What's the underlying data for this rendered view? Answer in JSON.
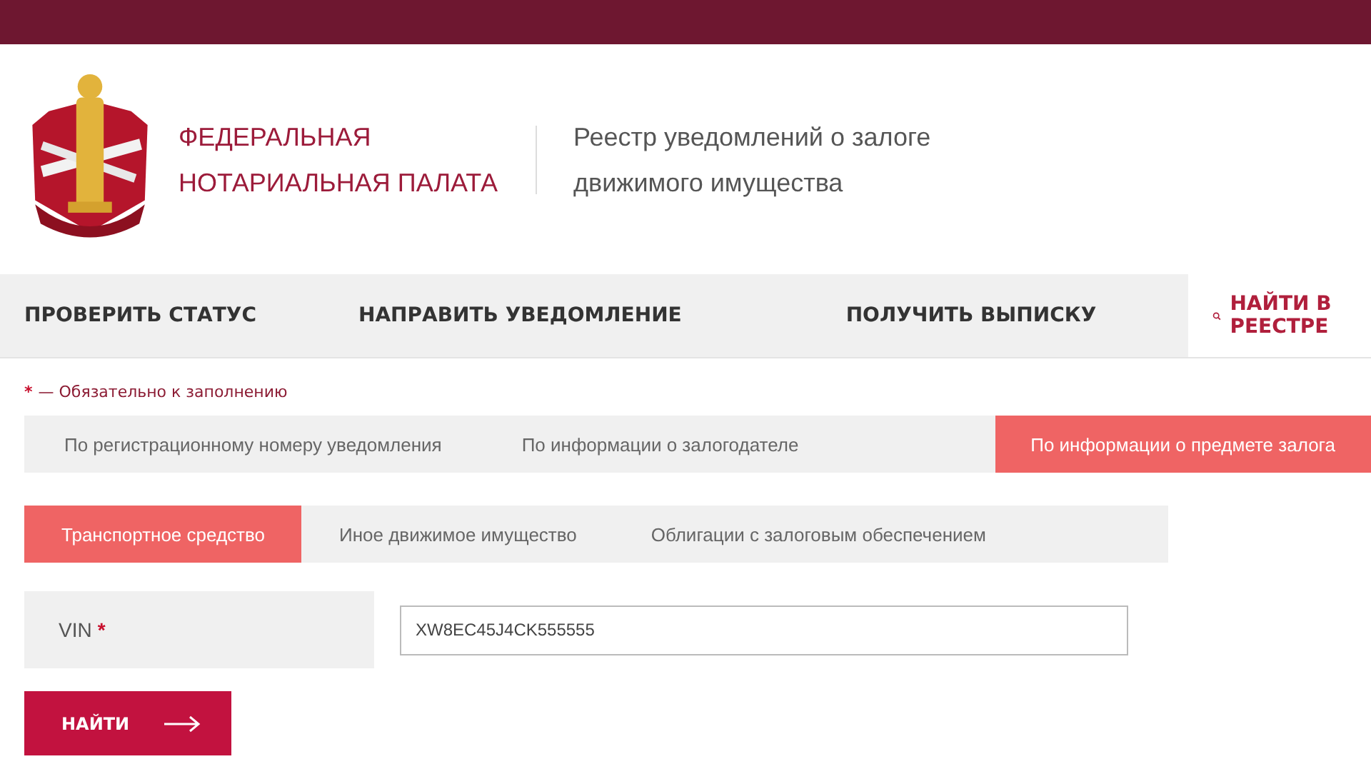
{
  "header": {
    "org_name": [
      "ФЕДЕРАЛЬНАЯ",
      "НОТАРИАЛЬНАЯ ПАЛАТА"
    ],
    "registry_title": [
      "Реестр уведомлений о залоге",
      "движимого имущества"
    ]
  },
  "nav": [
    {
      "label": "ПРОВЕРИТЬ СТАТУС",
      "selected": false
    },
    {
      "label": "НАПРАВИТЬ УВЕДОМЛЕНИЕ",
      "selected": false
    },
    {
      "label": "ПОЛУЧИТЬ ВЫПИСКУ",
      "selected": false
    },
    {
      "label": "НАЙТИ В РЕЕСТРЕ",
      "selected": true
    }
  ],
  "required_note": {
    "mark": "*",
    "text": "— Обязательно к заполнению"
  },
  "search_tabs": [
    {
      "label": "По регистрационному номеру уведомления",
      "selected": false
    },
    {
      "label": "По информации о залогодателе",
      "selected": false
    },
    {
      "label": "По информации о предмете залога",
      "selected": true
    }
  ],
  "subject_tabs": [
    {
      "label": "Транспортное средство",
      "selected": true
    },
    {
      "label": "Иное движимое имущество",
      "selected": false
    },
    {
      "label": "Облигации с залоговым обеспечением",
      "selected": false
    }
  ],
  "vin": {
    "label": "VIN",
    "required_mark": "*",
    "value": "XW8EC45J4CK555555"
  },
  "submit": {
    "label": "НАЙТИ"
  }
}
